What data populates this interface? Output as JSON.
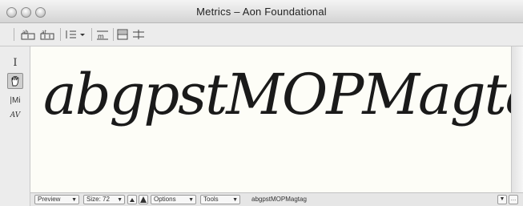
{
  "window": {
    "title": "Metrics – Aon Foundational"
  },
  "toolbar": {
    "buttons": [
      {
        "name": "metrics-view-icon"
      },
      {
        "name": "kerning-view-icon"
      },
      {
        "name": "line-spacing-icon"
      },
      {
        "name": "text-metrics-icon"
      },
      {
        "name": "split-view-icon"
      },
      {
        "name": "guides-icon"
      }
    ]
  },
  "sidebar": {
    "tools": [
      {
        "name": "text-cursor-icon",
        "glyph": "I"
      },
      {
        "name": "hand-tool-icon"
      },
      {
        "name": "metrics-tool-icon",
        "glyph": "|Mi"
      },
      {
        "name": "kerning-tool-icon",
        "glyph": "AV"
      }
    ]
  },
  "canvas": {
    "sample_text": "abgpstMOPMagtag"
  },
  "status": {
    "preview_label": "Preview",
    "size_label": "Size: 72",
    "options_label": "Options",
    "tools_label": "Tools",
    "text_field_value": "abgpstMOPMagtag"
  }
}
